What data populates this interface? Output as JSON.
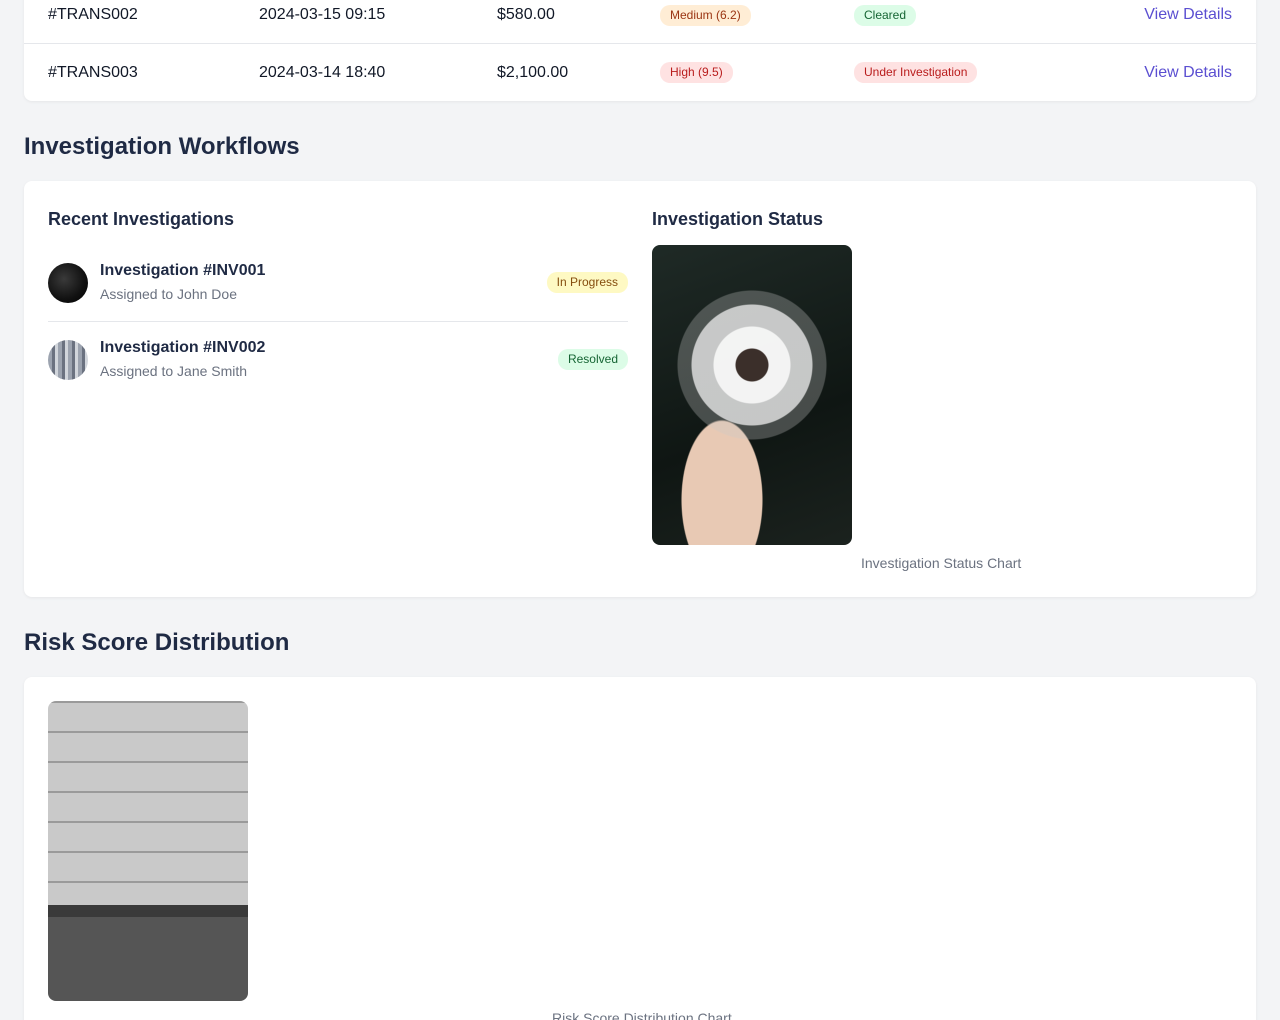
{
  "transactions": {
    "rows": [
      {
        "id": "#TRANS002",
        "date": "2024-03-15 09:15",
        "amount": "$580.00",
        "risk": "Medium (6.2)",
        "status": "Cleared",
        "action": "View Details"
      },
      {
        "id": "#TRANS003",
        "date": "2024-03-14 18:40",
        "amount": "$2,100.00",
        "risk": "High (9.5)",
        "status": "Under Investigation",
        "action": "View Details"
      }
    ]
  },
  "workflows": {
    "title": "Investigation Workflows",
    "recent_title": "Recent Investigations",
    "items": [
      {
        "name": "Investigation #INV001",
        "assigned": "Assigned to John Doe",
        "status": "In Progress"
      },
      {
        "name": "Investigation #INV002",
        "assigned": "Assigned to Jane Smith",
        "status": "Resolved"
      }
    ],
    "status_title": "Investigation Status",
    "status_caption": "Investigation Status Chart"
  },
  "risk": {
    "title": "Risk Score Distribution",
    "caption": "Risk Score Distribution Chart"
  },
  "colors": {
    "accent": "#5b4fd1",
    "heading": "#1f2a44",
    "background": "#f3f4f6"
  }
}
